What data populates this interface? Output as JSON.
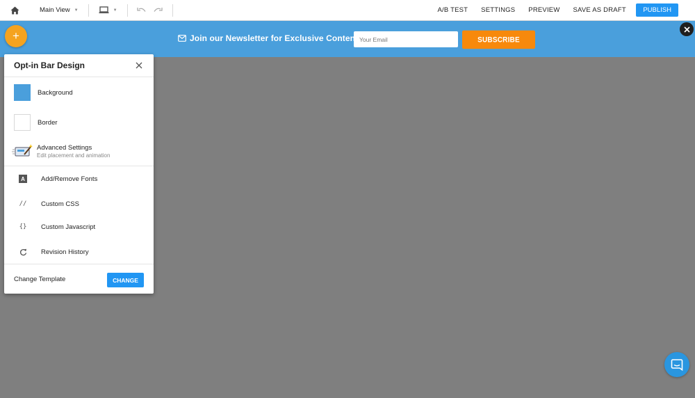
{
  "toolbar": {
    "home_icon": "home-icon",
    "view_label": "Main View",
    "device_icon": "laptop-icon",
    "undo_icon": "undo-icon",
    "redo_icon": "redo-icon",
    "actions": {
      "ab_test": "A/B TEST",
      "settings": "SETTINGS",
      "preview": "PREVIEW",
      "save_draft": "SAVE AS DRAFT",
      "publish": "PUBLISH"
    }
  },
  "newsletter_bar": {
    "text": "Join our Newsletter for Exclusive Content",
    "email_placeholder": "Your Email",
    "subscribe_label": "SUBSCRIBE",
    "background_color": "#4a9fdc",
    "button_color": "#f7890c"
  },
  "add_button_label": "+",
  "panel": {
    "title": "Opt-in Bar Design",
    "background_label": "Background",
    "background_color": "#4a9fdc",
    "border_label": "Border",
    "border_color": "#ffffff",
    "advanced_title": "Advanced Settings",
    "advanced_subtitle": "Edit placement and animation",
    "tools": [
      {
        "icon": "A",
        "label": "Add/Remove Fonts"
      },
      {
        "icon": "//",
        "label": "Custom CSS"
      },
      {
        "icon": "{}",
        "label": "Custom Javascript"
      },
      {
        "icon": "refresh-icon",
        "label": "Revision History"
      }
    ],
    "footer_label": "Change Template",
    "change_label": "CHANGE"
  },
  "colors": {
    "accent": "#2196f3",
    "canvas": "#7f7f7f",
    "fab": "#f5a31f"
  }
}
